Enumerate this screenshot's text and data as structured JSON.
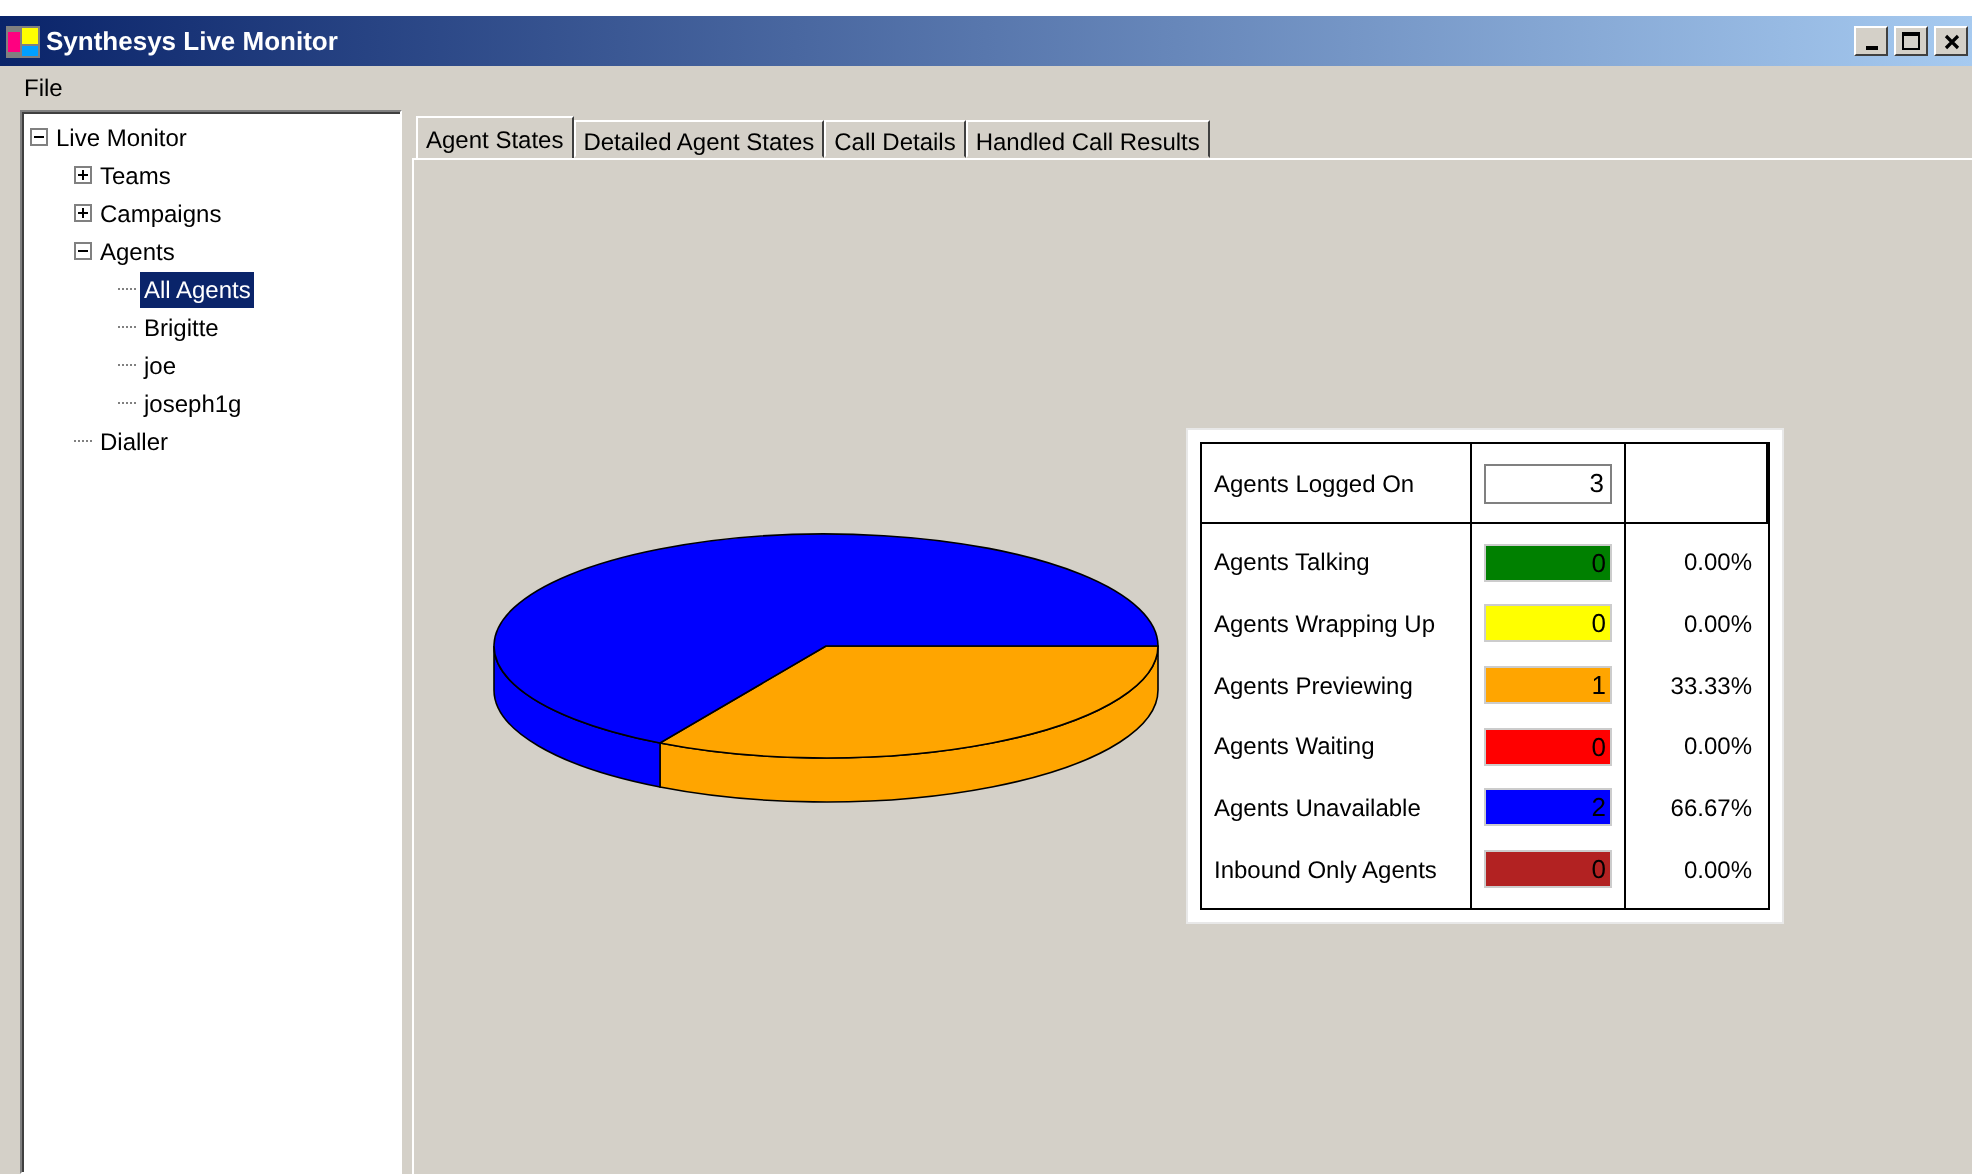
{
  "window": {
    "title": "Synthesys Live Monitor"
  },
  "menu": [
    "File"
  ],
  "tree": [
    {
      "label": "Live Monitor",
      "expanded": true,
      "selected": false,
      "children": [
        {
          "label": "Teams",
          "expanded": false,
          "selected": false
        },
        {
          "label": "Campaigns",
          "expanded": false,
          "selected": false
        },
        {
          "label": "Agents",
          "expanded": true,
          "selected": false,
          "children": [
            {
              "label": "All Agents",
              "selected": true
            },
            {
              "label": "Brigitte",
              "selected": false
            },
            {
              "label": "joe",
              "selected": false
            },
            {
              "label": "joseph1g",
              "selected": false
            }
          ]
        },
        {
          "label": "Dialler",
          "selected": false
        }
      ]
    }
  ],
  "tabs": [
    {
      "label": "Agent States",
      "selected": true
    },
    {
      "label": "Detailed Agent States",
      "selected": false
    },
    {
      "label": "Call Details",
      "selected": false
    },
    {
      "label": "Handled Call Results",
      "selected": false
    }
  ],
  "summary": {
    "label": "Agents Logged On",
    "value": "3"
  },
  "rows": [
    {
      "label": "Agents Talking",
      "count": "0",
      "percent": "0.00%",
      "color": "#008000"
    },
    {
      "label": "Agents Wrapping Up",
      "count": "0",
      "percent": "0.00%",
      "color": "#ffff00"
    },
    {
      "label": "Agents Previewing",
      "count": "1",
      "percent": "33.33%",
      "color": "#ffa500"
    },
    {
      "label": "Agents Waiting",
      "count": "0",
      "percent": "0.00%",
      "color": "#ff0000"
    },
    {
      "label": "Agents Unavailable",
      "count": "2",
      "percent": "66.67%",
      "color": "#0000ff"
    },
    {
      "label": "Inbound Only Agents",
      "count": "0",
      "percent": "0.00%",
      "color": "#b22222"
    }
  ]
}
